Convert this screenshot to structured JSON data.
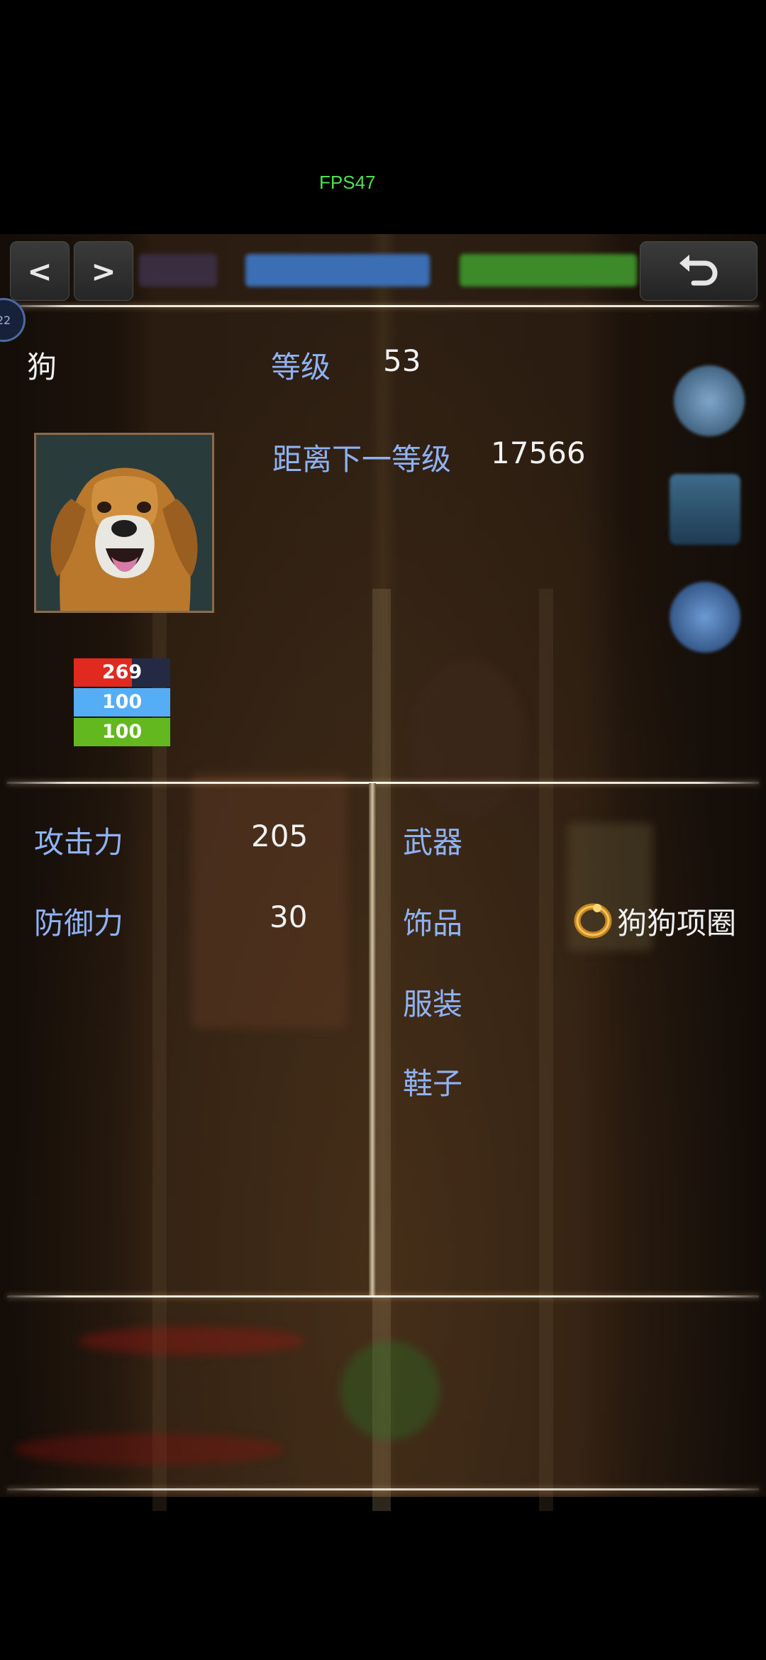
{
  "fps": "FPS47",
  "nav": {
    "prev": "<",
    "next": ">"
  },
  "avatar_badge": "22",
  "character": {
    "name": "狗",
    "level_label": "等级",
    "level_value": "53",
    "next_label": "距离下一等级",
    "next_value": "17566"
  },
  "bars": {
    "hp": {
      "value": "269",
      "fill": 0.6,
      "color": "#e02a1f"
    },
    "mp": {
      "value": "100",
      "fill": 1.0,
      "color": "#55adf5"
    },
    "sp": {
      "value": "100",
      "fill": 1.0,
      "color": "#62b81e"
    }
  },
  "stats": [
    {
      "label": "攻击力",
      "value": "205"
    },
    {
      "label": "防御力",
      "value": "30"
    }
  ],
  "equipment": [
    {
      "slot": "武器",
      "item": ""
    },
    {
      "slot": "饰品",
      "item": "狗狗项圈",
      "icon": "ring-icon"
    },
    {
      "slot": "服装",
      "item": ""
    },
    {
      "slot": "鞋子",
      "item": ""
    }
  ]
}
